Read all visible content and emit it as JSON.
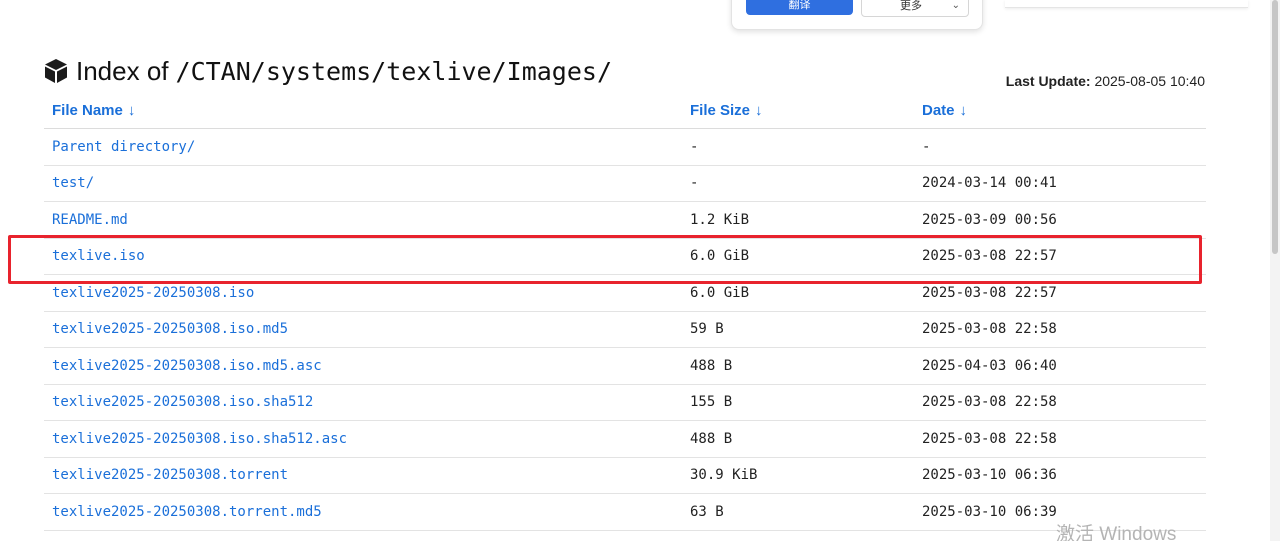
{
  "popup": {
    "translate_label": "翻译",
    "more_label": "更多"
  },
  "header": {
    "title_prefix": "Index of",
    "title_path": "/CTAN/systems/texlive/Images/",
    "last_update_label": "Last Update:",
    "last_update_value": "2025-08-05 10:40"
  },
  "table": {
    "columns": [
      {
        "label": "File Name",
        "arrow": "↓"
      },
      {
        "label": "File Size",
        "arrow": "↓"
      },
      {
        "label": "Date",
        "arrow": "↓"
      }
    ],
    "rows": [
      {
        "name": "Parent directory/",
        "size": "-",
        "date": "-"
      },
      {
        "name": "test/",
        "size": "-",
        "date": "2024-03-14 00:41"
      },
      {
        "name": "README.md",
        "size": "1.2 KiB",
        "date": "2025-03-09 00:56"
      },
      {
        "name": "texlive.iso",
        "size": "6.0 GiB",
        "date": "2025-03-08 22:57"
      },
      {
        "name": "texlive2025-20250308.iso",
        "size": "6.0 GiB",
        "date": "2025-03-08 22:57"
      },
      {
        "name": "texlive2025-20250308.iso.md5",
        "size": "59 B",
        "date": "2025-03-08 22:58"
      },
      {
        "name": "texlive2025-20250308.iso.md5.asc",
        "size": "488 B",
        "date": "2025-04-03 06:40"
      },
      {
        "name": "texlive2025-20250308.iso.sha512",
        "size": "155 B",
        "date": "2025-03-08 22:58"
      },
      {
        "name": "texlive2025-20250308.iso.sha512.asc",
        "size": "488 B",
        "date": "2025-03-08 22:58"
      },
      {
        "name": "texlive2025-20250308.torrent",
        "size": "30.9 KiB",
        "date": "2025-03-10 06:36"
      },
      {
        "name": "texlive2025-20250308.torrent.md5",
        "size": "63 B",
        "date": "2025-03-10 06:39"
      }
    ]
  },
  "watermark": "激活 Windows",
  "colors": {
    "link": "#1a6fd9",
    "highlight": "#e8232d",
    "button": "#2f6fe0"
  }
}
